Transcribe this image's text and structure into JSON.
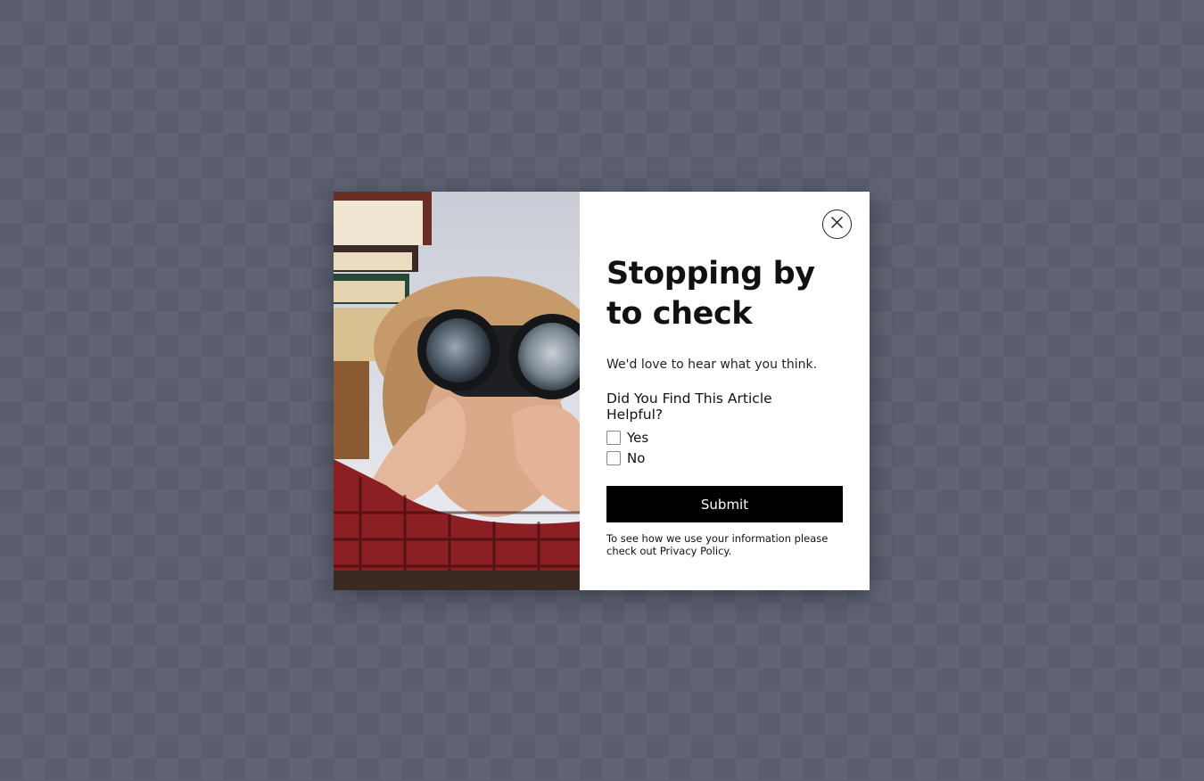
{
  "popup": {
    "headline_line1": "Stopping by",
    "headline_line2": "to check",
    "subtext": "We'd love to hear what you think.",
    "question_line1": "Did You Find This Article",
    "question_line2": "Helpful?",
    "options": [
      {
        "label": "Yes",
        "checked": false
      },
      {
        "label": "No",
        "checked": false
      }
    ],
    "submit_label": "Submit",
    "privacy_line1": "To see how we use your information please",
    "privacy_line2_prefix": "check out ",
    "privacy_link": "Privacy Policy",
    "privacy_line2_suffix": ".",
    "close_icon": "close-icon",
    "image_subject": "person-with-binoculars"
  },
  "colors": {
    "backdrop": "#5a5e70",
    "button": "#000000",
    "button_text": "#ffffff",
    "panel": "#ffffff"
  }
}
